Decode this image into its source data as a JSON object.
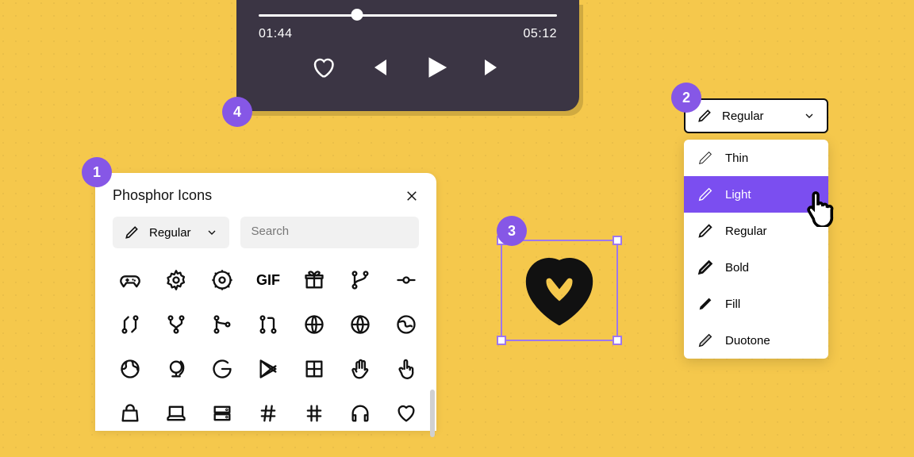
{
  "badges": {
    "b1": "1",
    "b2": "2",
    "b3": "3",
    "b4": "4"
  },
  "player": {
    "time_current": "01:44",
    "time_total": "05:12"
  },
  "panel": {
    "title": "Phosphor Icons",
    "weight_selected": "Regular",
    "search_placeholder": "Search"
  },
  "style_picker": {
    "selected": "Regular",
    "options": {
      "thin": "Thin",
      "light": "Light",
      "regular": "Regular",
      "bold": "Bold",
      "fill": "Fill",
      "duotone": "Duotone"
    }
  },
  "icons": {
    "gif_label": "GIF"
  }
}
